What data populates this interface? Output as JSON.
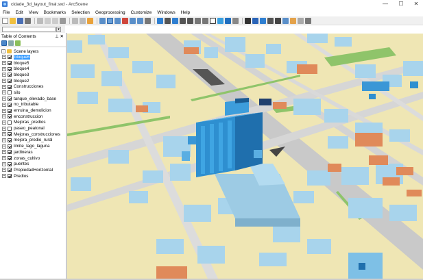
{
  "window": {
    "title": "cidade_3d_layout_final.sxd - ArcScene",
    "minimize": "—",
    "maximize": "☐",
    "close": "✕"
  },
  "menu": [
    "File",
    "Edit",
    "View",
    "Bookmarks",
    "Selection",
    "Geoprocessing",
    "Customize",
    "Windows",
    "Help"
  ],
  "toc": {
    "title": "Table of Contents",
    "pin": "⊥ ✕",
    "root": "Scene layers",
    "layers": [
      {
        "name": "bloque6",
        "checked": true,
        "selected": true
      },
      {
        "name": "bloque5",
        "checked": true
      },
      {
        "name": "bloque4",
        "checked": true
      },
      {
        "name": "bloque3",
        "checked": true
      },
      {
        "name": "bloque2",
        "checked": true
      },
      {
        "name": "Construcciones",
        "checked": true
      },
      {
        "name": "silo",
        "checked": false
      },
      {
        "name": "tanque_elevado_base",
        "checked": true
      },
      {
        "name": "no_tributable",
        "checked": true
      },
      {
        "name": "enruina_demolicion",
        "checked": true
      },
      {
        "name": "enconstruccion",
        "checked": true
      },
      {
        "name": "Mejoras_predios",
        "checked": false
      },
      {
        "name": "paseo_peatonal",
        "checked": false
      },
      {
        "name": "Mejoras_construcciones",
        "checked": true
      },
      {
        "name": "mejora_predio_rural",
        "checked": true
      },
      {
        "name": "limite_lago_laguna",
        "checked": true
      },
      {
        "name": "jardineras",
        "checked": true
      },
      {
        "name": "zonas_cultivo",
        "checked": true
      },
      {
        "name": "puentes",
        "checked": true
      },
      {
        "name": "PropiedadHorizontal",
        "checked": true
      },
      {
        "name": "Predios",
        "checked": true
      }
    ]
  },
  "colors": {
    "ground": "#efe6b4",
    "building": "#a8d4ec",
    "tower": "#2e8fd0",
    "road": "#c8c8c8",
    "grass": "#8fc46a",
    "roof_orange": "#e08a5a"
  }
}
